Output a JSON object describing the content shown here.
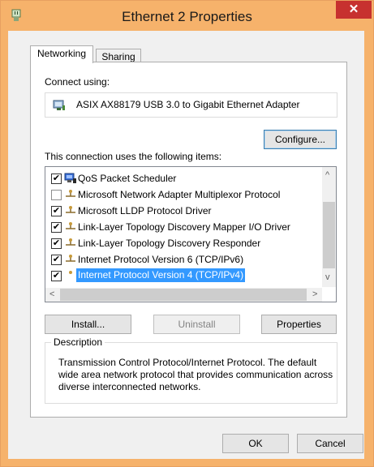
{
  "window": {
    "title": "Ethernet 2 Properties",
    "close_glyph": "✕",
    "accent": "#f6b26b"
  },
  "tabs": [
    {
      "label": "Networking"
    },
    {
      "label": "Sharing"
    }
  ],
  "connect": {
    "label": "Connect using:",
    "adapter": "ASIX AX88179 USB 3.0 to Gigabit Ethernet Adapter",
    "configure_label": "Configure..."
  },
  "items_label": "This connection uses the following items:",
  "items": [
    {
      "label": "QoS Packet Scheduler",
      "checked": true,
      "icon": "qos-scheduler-icon"
    },
    {
      "label": "Microsoft Network Adapter Multiplexor Protocol",
      "checked": false,
      "icon": "protocol-icon"
    },
    {
      "label": "Microsoft LLDP Protocol Driver",
      "checked": true,
      "icon": "protocol-icon"
    },
    {
      "label": "Link-Layer Topology Discovery Mapper I/O Driver",
      "checked": true,
      "icon": "protocol-icon"
    },
    {
      "label": "Link-Layer Topology Discovery Responder",
      "checked": true,
      "icon": "protocol-icon"
    },
    {
      "label": "Internet Protocol Version 6 (TCP/IPv6)",
      "checked": true,
      "icon": "protocol-icon"
    },
    {
      "label": "Internet Protocol Version 4 (TCP/IPv4)",
      "checked": true,
      "icon": "protocol-icon",
      "selected": true
    }
  ],
  "buttons": {
    "install": "Install...",
    "uninstall": "Uninstall",
    "properties": "Properties",
    "ok": "OK",
    "cancel": "Cancel"
  },
  "description": {
    "title": "Description",
    "text": "Transmission Control Protocol/Internet Protocol. The default wide area network protocol that provides communication across diverse interconnected networks."
  }
}
